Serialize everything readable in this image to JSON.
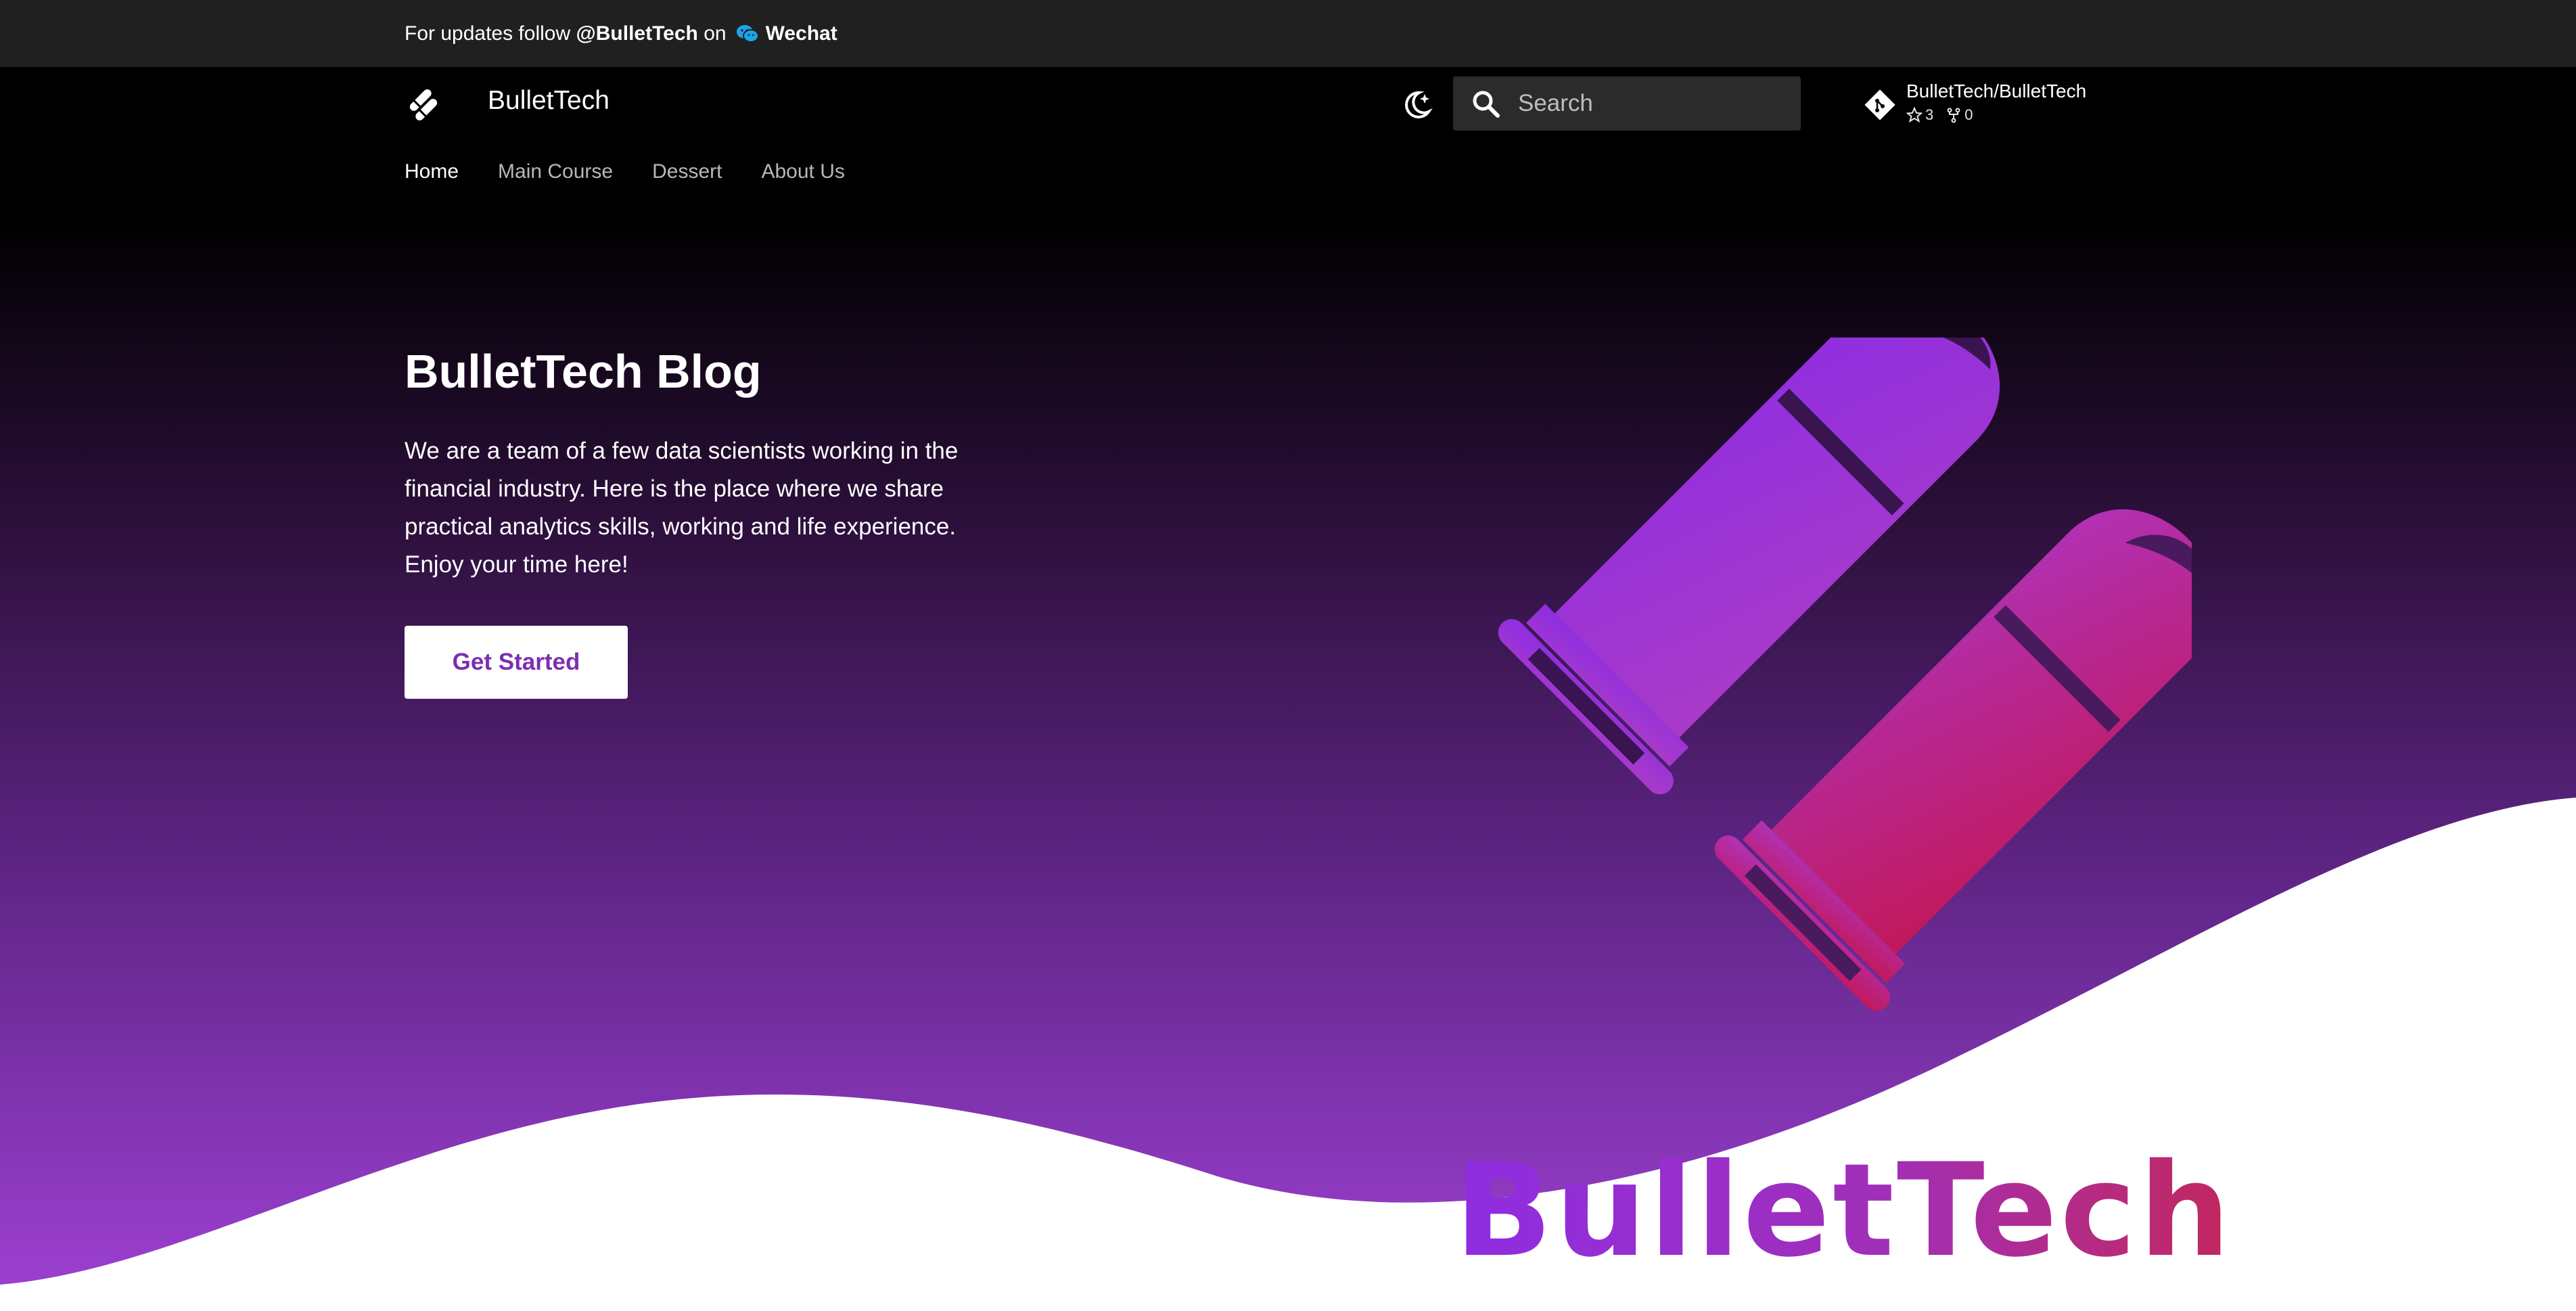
{
  "announcement": {
    "prefix": "For updates follow",
    "handle": "@BulletTech",
    "middle": "on",
    "channel": "Wechat",
    "icon": "wechat-icon"
  },
  "header": {
    "site_title": "BulletTech",
    "logo_icon": "bullet-logo-icon",
    "theme_toggle_icon": "moon-icon",
    "search": {
      "placeholder": "Search",
      "icon": "search-icon"
    },
    "repo": {
      "name": "BulletTech/BulletTech",
      "stars": "3",
      "forks": "0",
      "icon": "git-icon"
    }
  },
  "tabs": [
    {
      "label": "Home",
      "active": true
    },
    {
      "label": "Main Course",
      "active": false
    },
    {
      "label": "Dessert",
      "active": false
    },
    {
      "label": "About Us",
      "active": false
    }
  ],
  "hero": {
    "title": "BulletTech Blog",
    "description": "We are a team of a few data scientists working in the financial industry. Here is the place where we share practical analytics skills, working and life experience. Enjoy your time here!",
    "cta_label": "Get Started",
    "brand_text": "BulletTech"
  },
  "colors": {
    "announcement_bg": "#202020",
    "header_bg": "#000000",
    "gradient_purple": "#8e2de2",
    "gradient_red": "#c2185b",
    "cta_text": "#7b2fb0"
  }
}
